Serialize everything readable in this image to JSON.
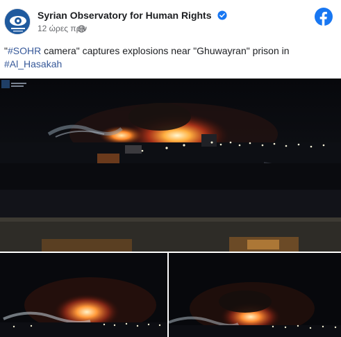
{
  "post": {
    "page_name": "Syrian Observatory for Human Rights",
    "timestamp": "12 ώρες πριν",
    "text": {
      "part1": "\"",
      "hashtag1": "#SOHR",
      "part2": " camera\" captures explosions near \"Ghuwayran\" prison in",
      "hashtag2": "#Al_Hasakah"
    }
  },
  "icons": {
    "verified": "verified-badge-icon",
    "privacy": "globe-icon",
    "brand": "facebook-icon"
  },
  "colors": {
    "link": "#365899",
    "facebook_blue": "#1877f2",
    "name_text": "#1c1e21",
    "meta_text": "#65676b"
  }
}
